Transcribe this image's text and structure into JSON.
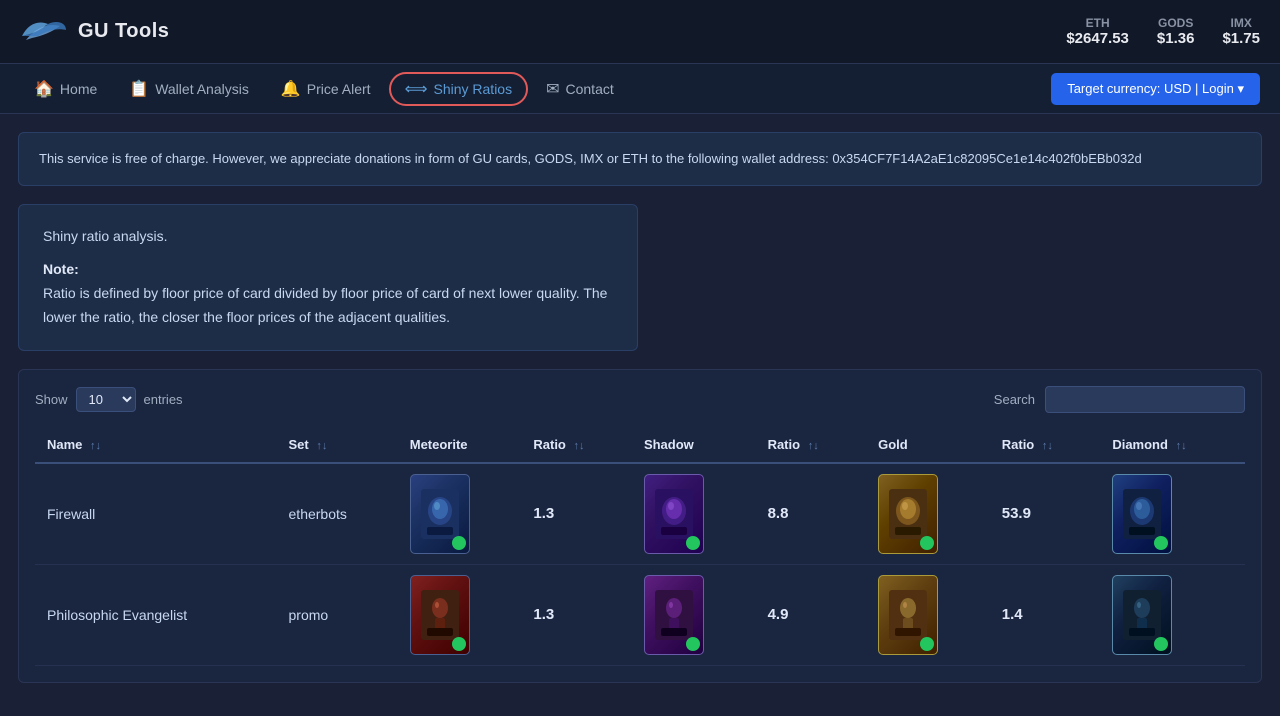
{
  "header": {
    "title": "GU Tools",
    "prices": [
      {
        "label": "ETH",
        "value": "$2647.53"
      },
      {
        "label": "GODS",
        "value": "$1.36"
      },
      {
        "label": "IMX",
        "value": "$1.75"
      }
    ]
  },
  "nav": {
    "items": [
      {
        "id": "home",
        "label": "Home",
        "icon": "🏠",
        "active": false
      },
      {
        "id": "wallet-analysis",
        "label": "Wallet Analysis",
        "icon": "📋",
        "active": false
      },
      {
        "id": "price-alert",
        "label": "Price Alert",
        "icon": "🔔",
        "active": false
      },
      {
        "id": "shiny-ratios",
        "label": "Shiny Ratios",
        "icon": "⟺",
        "active": true
      },
      {
        "id": "contact",
        "label": "Contact",
        "icon": "✉",
        "active": false
      }
    ],
    "target_currency_btn": "Target currency: USD | Login ▾"
  },
  "notice": {
    "text": "This service is free of charge. However, we appreciate donations in form of GU cards, GODS, IMX or ETH to the following wallet address: 0x354CF7F14A2aE1c82095Ce1e14c402f0bEBb032d"
  },
  "info": {
    "title": "Shiny ratio analysis.",
    "note_label": "Note:",
    "note_text": "Ratio is defined by floor price of card divided by floor price of card of next lower quality. The lower the ratio, the closer the floor prices of the adjacent qualities."
  },
  "table": {
    "show_label": "Show",
    "entries_label": "entries",
    "search_label": "Search",
    "search_placeholder": "",
    "columns": [
      {
        "id": "name",
        "label": "Name"
      },
      {
        "id": "set",
        "label": "Set"
      },
      {
        "id": "meteorite",
        "label": "Meteorite"
      },
      {
        "id": "ratio1",
        "label": "Ratio"
      },
      {
        "id": "shadow",
        "label": "Shadow"
      },
      {
        "id": "ratio2",
        "label": "Ratio"
      },
      {
        "id": "gold",
        "label": "Gold"
      },
      {
        "id": "ratio3",
        "label": "Ratio"
      },
      {
        "id": "diamond",
        "label": "Diamond"
      }
    ],
    "rows": [
      {
        "name": "Firewall",
        "set": "etherbots",
        "meteorite_art": "firewall-met",
        "ratio1": "1.3",
        "shadow_art": "firewall-shadow",
        "ratio2": "8.8",
        "gold_art": "firewall-gold",
        "ratio3": "53.9",
        "diamond_art": "firewall-diamond"
      },
      {
        "name": "Philosophic Evangelist",
        "set": "promo",
        "meteorite_art": "phil-met",
        "ratio1": "1.3",
        "shadow_art": "phil-shadow",
        "ratio2": "4.9",
        "gold_art": "phil-gold",
        "ratio3": "1.4",
        "diamond_art": "phil-diamond"
      }
    ]
  }
}
